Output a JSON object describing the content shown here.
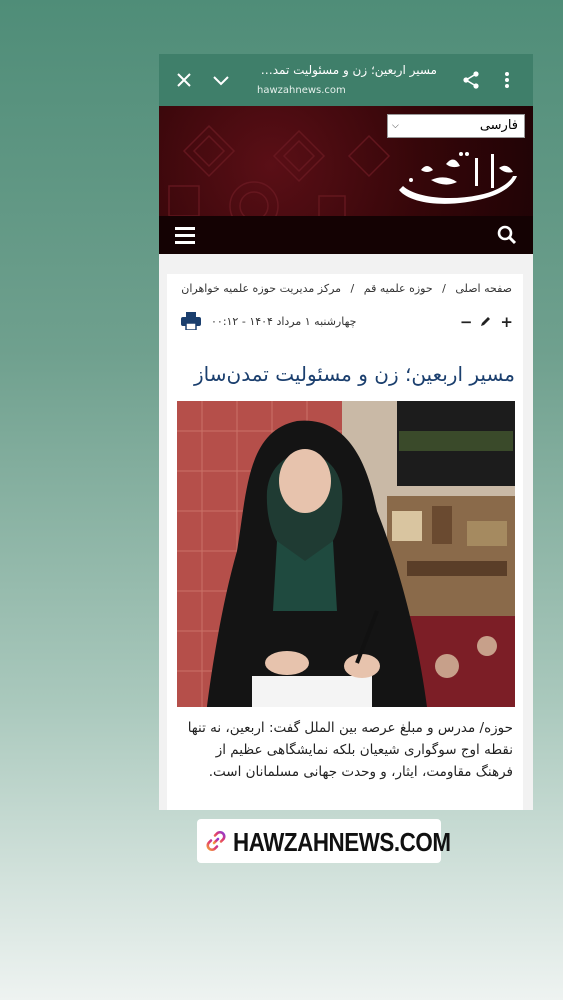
{
  "browser": {
    "page_title": "مسیر اربعین؛ زن و مسئولیت تمدن‌س...",
    "url": "hawzahnews.com",
    "icons": [
      "close-icon",
      "chevron-down-icon",
      "share-icon",
      "more-vert-icon"
    ]
  },
  "site_header": {
    "language_select": "فارسی",
    "logo_text": "خبرگزاری حوزه",
    "icons": [
      "menu-icon",
      "search-icon"
    ]
  },
  "article": {
    "breadcrumbs": [
      "صفحه اصلی",
      "حوزه علمیه قم",
      "مرکز مدیریت حوزه علمیه خواهران"
    ],
    "breadcrumb_sep": "/",
    "date": "چهارشنبه ۱ مرداد ۱۴۰۴ - ۰۰:۱۲",
    "tool_icons": [
      "plus-icon",
      "pencil-icon",
      "minus-icon",
      "print-icon"
    ],
    "title": "مسیر اربعین؛ زن و مسئولیت تمدن‌ساز",
    "summary": "حوزه/ مدرس و مبلغ عرصه بین الملل گفت: اربعین، نه تنها نقطه اوج سوگواری شیعیان بلکه نمایشگاهی عظیم از فرهنگ مقاومت، ایثار، و وحدت جهانی مسلمانان است."
  },
  "footer_badge": {
    "text": "HAWZAHNEWS.COM",
    "icon": "link-icon"
  },
  "colors": {
    "appbar": "#3f7f6a",
    "header": "#350609",
    "headline": "#1b3f6e"
  }
}
